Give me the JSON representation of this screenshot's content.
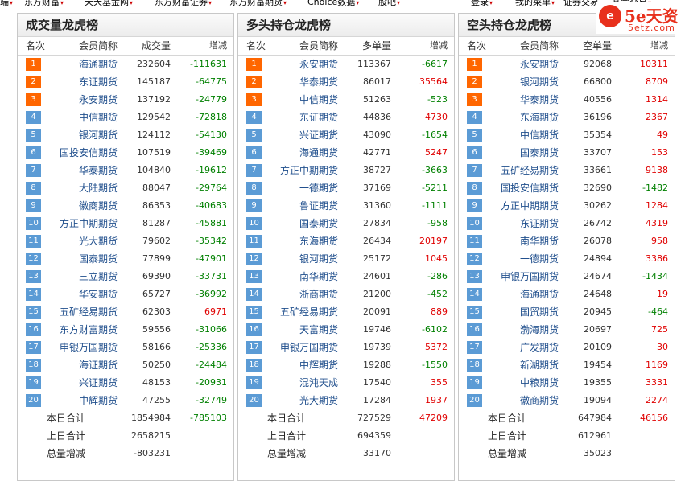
{
  "topnav": [
    {
      "label": "端",
      "arrow": true
    },
    {
      "label": "东方财富",
      "arrow": true
    },
    {
      "label": "天天基金网",
      "arrow": true
    },
    {
      "label": "东方财富证券",
      "arrow": true
    },
    {
      "label": "东方财富期货",
      "arrow": true
    },
    {
      "label": "Choice数据",
      "arrow": true
    },
    {
      "label": "股吧",
      "arrow": true
    },
    {
      "label": "登录",
      "arrow": true
    },
    {
      "label": "我的菜单",
      "arrow": true
    },
    {
      "label": "证券交易",
      "arrow": false
    },
    {
      "label": "基金交易",
      "arrow": true
    }
  ],
  "logo": {
    "brand": "5e天资",
    "domain": "5etz.com",
    "mark": "e"
  },
  "panels": [
    {
      "title": "成交量龙虎榜",
      "headers": [
        "名次",
        "会员简称",
        "成交量",
        "增减"
      ],
      "rows": [
        {
          "rank": "1",
          "name": "海通期货",
          "vol": "232604",
          "chg": "-111631"
        },
        {
          "rank": "2",
          "name": "东证期货",
          "vol": "145187",
          "chg": "-64775"
        },
        {
          "rank": "3",
          "name": "永安期货",
          "vol": "137192",
          "chg": "-24779"
        },
        {
          "rank": "4",
          "name": "中信期货",
          "vol": "129542",
          "chg": "-72818"
        },
        {
          "rank": "5",
          "name": "银河期货",
          "vol": "124112",
          "chg": "-54130"
        },
        {
          "rank": "6",
          "name": "国投安信期货",
          "vol": "107519",
          "chg": "-39469"
        },
        {
          "rank": "7",
          "name": "华泰期货",
          "vol": "104840",
          "chg": "-19612"
        },
        {
          "rank": "8",
          "name": "大陆期货",
          "vol": "88047",
          "chg": "-29764"
        },
        {
          "rank": "9",
          "name": "徽商期货",
          "vol": "86353",
          "chg": "-40683"
        },
        {
          "rank": "10",
          "name": "方正中期期货",
          "vol": "81287",
          "chg": "-45881"
        },
        {
          "rank": "11",
          "name": "光大期货",
          "vol": "79602",
          "chg": "-35342"
        },
        {
          "rank": "12",
          "name": "国泰期货",
          "vol": "77899",
          "chg": "-47901"
        },
        {
          "rank": "13",
          "name": "三立期货",
          "vol": "69390",
          "chg": "-33731"
        },
        {
          "rank": "14",
          "name": "华安期货",
          "vol": "65727",
          "chg": "-36992"
        },
        {
          "rank": "15",
          "name": "五矿经易期货",
          "vol": "62303",
          "chg": "6971"
        },
        {
          "rank": "16",
          "name": "东方财富期货",
          "vol": "59556",
          "chg": "-31066"
        },
        {
          "rank": "17",
          "name": "申银万国期货",
          "vol": "58166",
          "chg": "-25336"
        },
        {
          "rank": "18",
          "name": "海证期货",
          "vol": "50250",
          "chg": "-24484"
        },
        {
          "rank": "19",
          "name": "兴证期货",
          "vol": "48153",
          "chg": "-20931"
        },
        {
          "rank": "20",
          "name": "中辉期货",
          "vol": "47255",
          "chg": "-32749"
        }
      ],
      "summary": [
        {
          "label": "本日合计",
          "vol": "1854984",
          "chg": "-785103"
        },
        {
          "label": "上日合计",
          "vol": "2658215",
          "chg": ""
        },
        {
          "label": "总量增减",
          "vol": "-803231",
          "chg": ""
        }
      ]
    },
    {
      "title": "多头持仓龙虎榜",
      "headers": [
        "名次",
        "会员简称",
        "多单量",
        "增减"
      ],
      "rows": [
        {
          "rank": "1",
          "name": "永安期货",
          "vol": "113367",
          "chg": "-6617"
        },
        {
          "rank": "2",
          "name": "华泰期货",
          "vol": "86017",
          "chg": "35564"
        },
        {
          "rank": "3",
          "name": "中信期货",
          "vol": "51263",
          "chg": "-523"
        },
        {
          "rank": "4",
          "name": "东证期货",
          "vol": "44836",
          "chg": "4730"
        },
        {
          "rank": "5",
          "name": "兴证期货",
          "vol": "43090",
          "chg": "-1654"
        },
        {
          "rank": "6",
          "name": "海通期货",
          "vol": "42771",
          "chg": "5247"
        },
        {
          "rank": "7",
          "name": "方正中期期货",
          "vol": "38727",
          "chg": "-3663"
        },
        {
          "rank": "8",
          "name": "一德期货",
          "vol": "37169",
          "chg": "-5211"
        },
        {
          "rank": "9",
          "name": "鲁证期货",
          "vol": "31360",
          "chg": "-1111"
        },
        {
          "rank": "10",
          "name": "国泰期货",
          "vol": "27834",
          "chg": "-958"
        },
        {
          "rank": "11",
          "name": "东海期货",
          "vol": "26434",
          "chg": "20197"
        },
        {
          "rank": "12",
          "name": "银河期货",
          "vol": "25172",
          "chg": "1045"
        },
        {
          "rank": "13",
          "name": "南华期货",
          "vol": "24601",
          "chg": "-286"
        },
        {
          "rank": "14",
          "name": "浙商期货",
          "vol": "21200",
          "chg": "-452"
        },
        {
          "rank": "15",
          "name": "五矿经易期货",
          "vol": "20091",
          "chg": "889"
        },
        {
          "rank": "16",
          "name": "天富期货",
          "vol": "19746",
          "chg": "-6102"
        },
        {
          "rank": "17",
          "name": "申银万国期货",
          "vol": "19739",
          "chg": "5372"
        },
        {
          "rank": "18",
          "name": "中辉期货",
          "vol": "19288",
          "chg": "-1550"
        },
        {
          "rank": "19",
          "name": "混沌天成",
          "vol": "17540",
          "chg": "355"
        },
        {
          "rank": "20",
          "name": "光大期货",
          "vol": "17284",
          "chg": "1937"
        }
      ],
      "summary": [
        {
          "label": "本日合计",
          "vol": "727529",
          "chg": "47209"
        },
        {
          "label": "上日合计",
          "vol": "694359",
          "chg": ""
        },
        {
          "label": "总量增减",
          "vol": "33170",
          "chg": ""
        }
      ]
    },
    {
      "title": "空头持仓龙虎榜",
      "headers": [
        "名次",
        "会员简称",
        "空单量",
        "增减"
      ],
      "rows": [
        {
          "rank": "1",
          "name": "永安期货",
          "vol": "92068",
          "chg": "10311"
        },
        {
          "rank": "2",
          "name": "银河期货",
          "vol": "66800",
          "chg": "8709"
        },
        {
          "rank": "3",
          "name": "华泰期货",
          "vol": "40556",
          "chg": "1314"
        },
        {
          "rank": "4",
          "name": "东海期货",
          "vol": "36196",
          "chg": "2367"
        },
        {
          "rank": "5",
          "name": "中信期货",
          "vol": "35354",
          "chg": "49"
        },
        {
          "rank": "6",
          "name": "国泰期货",
          "vol": "33707",
          "chg": "153"
        },
        {
          "rank": "7",
          "name": "五矿经易期货",
          "vol": "33661",
          "chg": "9138"
        },
        {
          "rank": "8",
          "name": "国投安信期货",
          "vol": "32690",
          "chg": "-1482"
        },
        {
          "rank": "9",
          "name": "方正中期期货",
          "vol": "30262",
          "chg": "1284"
        },
        {
          "rank": "10",
          "name": "东证期货",
          "vol": "26742",
          "chg": "4319"
        },
        {
          "rank": "11",
          "name": "南华期货",
          "vol": "26078",
          "chg": "958"
        },
        {
          "rank": "12",
          "name": "一德期货",
          "vol": "24894",
          "chg": "3386"
        },
        {
          "rank": "13",
          "name": "申银万国期货",
          "vol": "24674",
          "chg": "-1434"
        },
        {
          "rank": "14",
          "name": "海通期货",
          "vol": "24648",
          "chg": "19"
        },
        {
          "rank": "15",
          "name": "国贸期货",
          "vol": "20945",
          "chg": "-464"
        },
        {
          "rank": "16",
          "name": "渤海期货",
          "vol": "20697",
          "chg": "725"
        },
        {
          "rank": "17",
          "name": "广发期货",
          "vol": "20109",
          "chg": "30"
        },
        {
          "rank": "18",
          "name": "新湖期货",
          "vol": "19454",
          "chg": "1169"
        },
        {
          "rank": "19",
          "name": "中粮期货",
          "vol": "19355",
          "chg": "3331"
        },
        {
          "rank": "20",
          "name": "徽商期货",
          "vol": "19094",
          "chg": "2274"
        }
      ],
      "summary": [
        {
          "label": "本日合计",
          "vol": "647984",
          "chg": "46156"
        },
        {
          "label": "上日合计",
          "vol": "612961",
          "chg": ""
        },
        {
          "label": "总量增减",
          "vol": "35023",
          "chg": ""
        }
      ]
    }
  ],
  "colors": {
    "positive": "#e00000",
    "negative": "#008000",
    "rank_top": "#ff6600",
    "rank_other": "#5b9bd5",
    "name_link": "#1f4e8c"
  }
}
